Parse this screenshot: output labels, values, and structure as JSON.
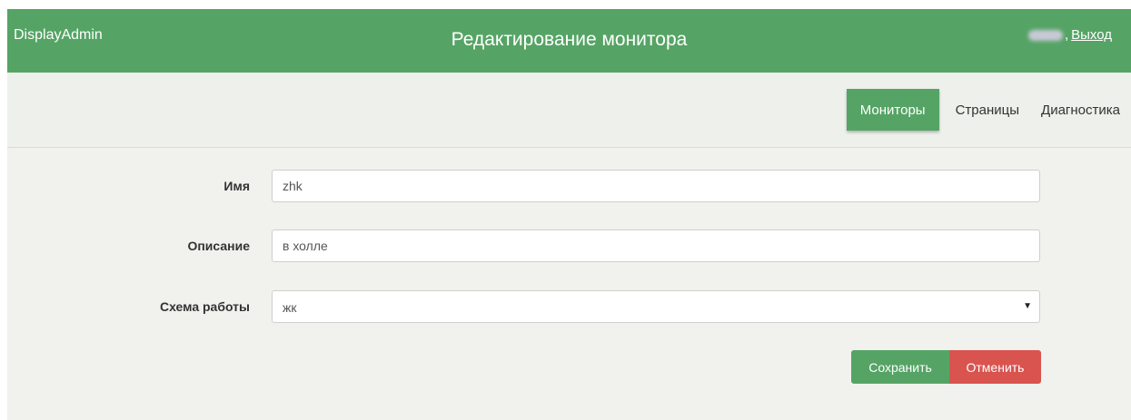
{
  "header": {
    "brand": "DisplayAdmin",
    "title": "Редактирование монитора",
    "comma": ",",
    "logout_label": "Выход"
  },
  "nav": {
    "items": [
      {
        "label": "Мониторы",
        "active": true
      },
      {
        "label": "Страницы",
        "active": false
      },
      {
        "label": "Диагностика",
        "active": false
      }
    ]
  },
  "form": {
    "name_label": "Имя",
    "name_value": "zhk",
    "description_label": "Описание",
    "description_value": "в холле",
    "scheme_label": "Схема работы",
    "scheme_value": "жк"
  },
  "actions": {
    "save_label": "Сохранить",
    "cancel_label": "Отменить"
  },
  "colors": {
    "accent_green": "#55a465",
    "danger_red": "#d9534f",
    "background": "#f1f2ee"
  },
  "icons": {
    "select_caret": "chevron-down-icon"
  }
}
